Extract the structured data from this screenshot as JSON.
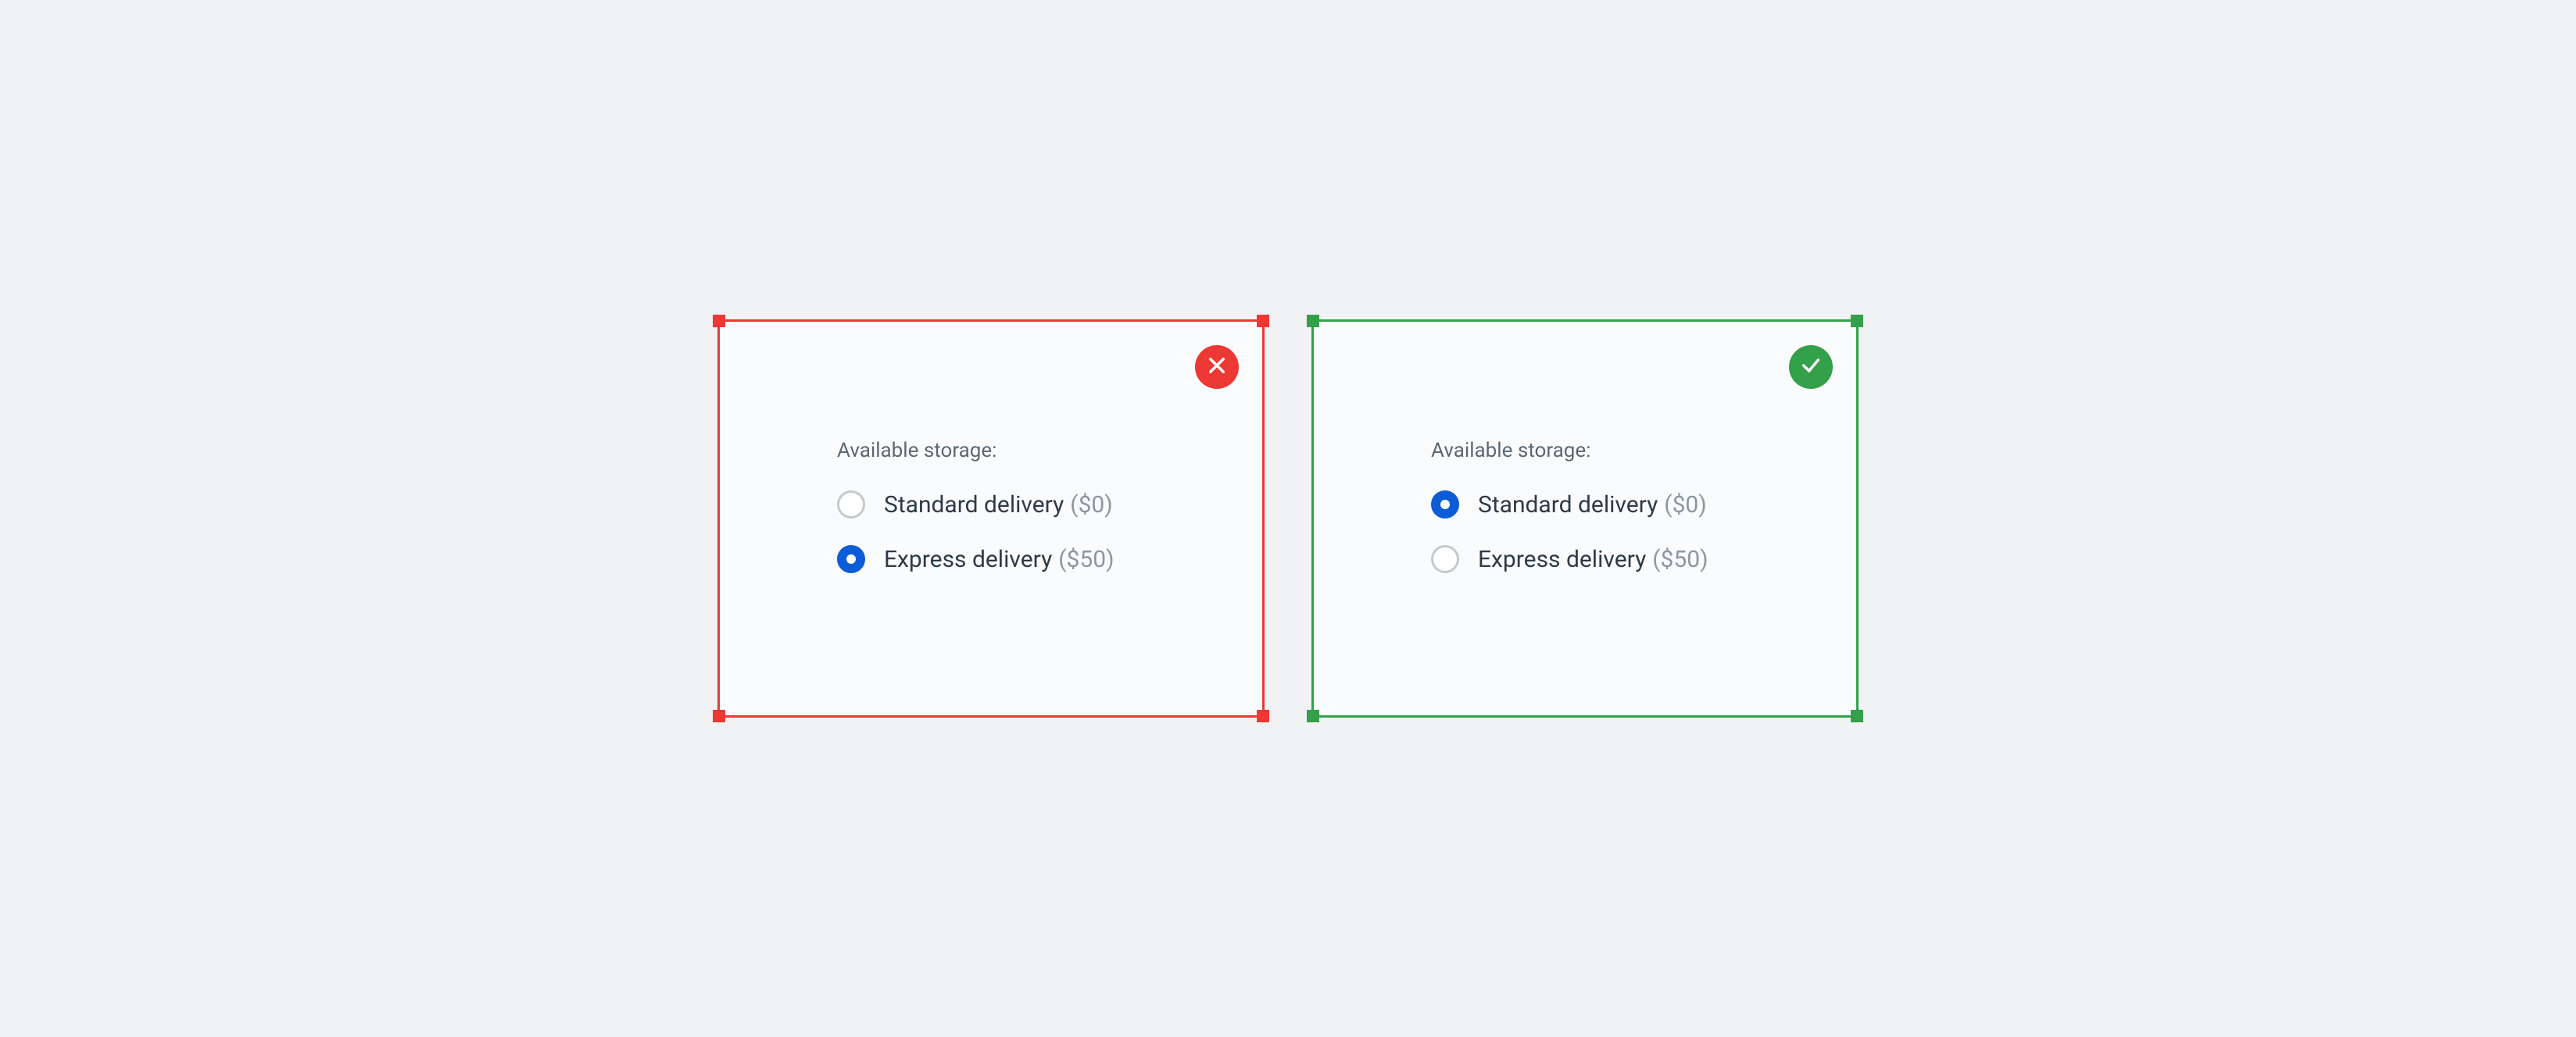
{
  "bad": {
    "status": "incorrect",
    "heading": "Available storage:",
    "options": [
      {
        "label": "Standard delivery",
        "price": "($0)",
        "checked": false
      },
      {
        "label": "Express delivery",
        "price": "($50)",
        "checked": true
      }
    ]
  },
  "good": {
    "status": "correct",
    "heading": "Available storage:",
    "options": [
      {
        "label": "Standard delivery",
        "price": "($0)",
        "checked": true
      },
      {
        "label": "Express delivery",
        "price": "($50)",
        "checked": false
      }
    ]
  },
  "colors": {
    "bad": "#ed3833",
    "good": "#33a04a",
    "accent": "#0d5cd7"
  }
}
